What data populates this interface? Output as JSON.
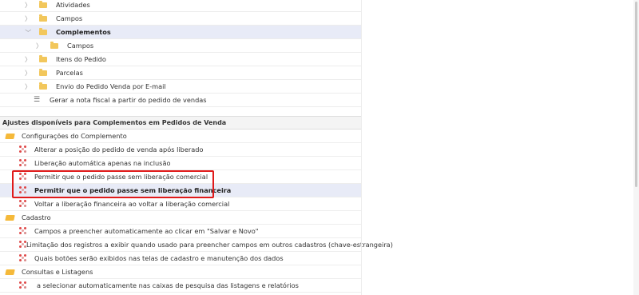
{
  "tree": [
    {
      "label": "Atividades",
      "level": 1,
      "expanded": false,
      "icon": "folder-icon"
    },
    {
      "label": "Campos",
      "level": 1,
      "expanded": false,
      "icon": "folder-icon"
    },
    {
      "label": "Complementos",
      "level": 1,
      "expanded": true,
      "icon": "folder-icon",
      "selected": true
    },
    {
      "label": "Campos",
      "level": 2,
      "expanded": false,
      "icon": "folder-icon"
    },
    {
      "label": "Itens do Pedido",
      "level": 1,
      "expanded": false,
      "icon": "folder-icon"
    },
    {
      "label": "Parcelas",
      "level": 1,
      "expanded": false,
      "icon": "folder-icon"
    },
    {
      "label": "Envio do Pedido Venda por E-mail",
      "level": 1,
      "expanded": false,
      "icon": "folder-icon"
    },
    {
      "label": "Gerar a nota fiscal a partir do pedido de vendas",
      "level": 1,
      "icon": "list-icon"
    }
  ],
  "settings": {
    "title": "Ajustes disponíveis para Complementos em Pedidos de Venda",
    "groups": [
      {
        "label": "Configurações do Complemento",
        "items": [
          {
            "label": "Alterar a posição do pedido de venda após liberado"
          },
          {
            "label": "Liberação automática apenas na inclusão"
          },
          {
            "label": "Permitir que o pedido passe sem liberação comercial"
          },
          {
            "label": "Permitir que o pedido passe sem liberação financeira",
            "selected": true
          },
          {
            "label": "Voltar a liberação financeira ao voltar a liberação comercial"
          }
        ]
      },
      {
        "label": "Cadastro",
        "items": [
          {
            "label": "Campos a preencher automaticamente ao clicar em \"Salvar e Novo\""
          },
          {
            "label": "Limitação dos registros a exibir quando usado para preencher campos em outros cadastros (chave-estrangeira)"
          },
          {
            "label": "Quais botões serão exibidos nas telas de cadastro e manutenção dos dados"
          }
        ]
      },
      {
        "label": "Consultas e Listagens",
        "items": [
          {
            "label": "a selecionar automaticamente nas caixas de pesquisa das listagens e relatórios"
          }
        ]
      }
    ]
  },
  "colors": {
    "highlight_border": "#e01a1a",
    "selected_row": "#e8ebf7",
    "folder": "#f2c75c"
  }
}
